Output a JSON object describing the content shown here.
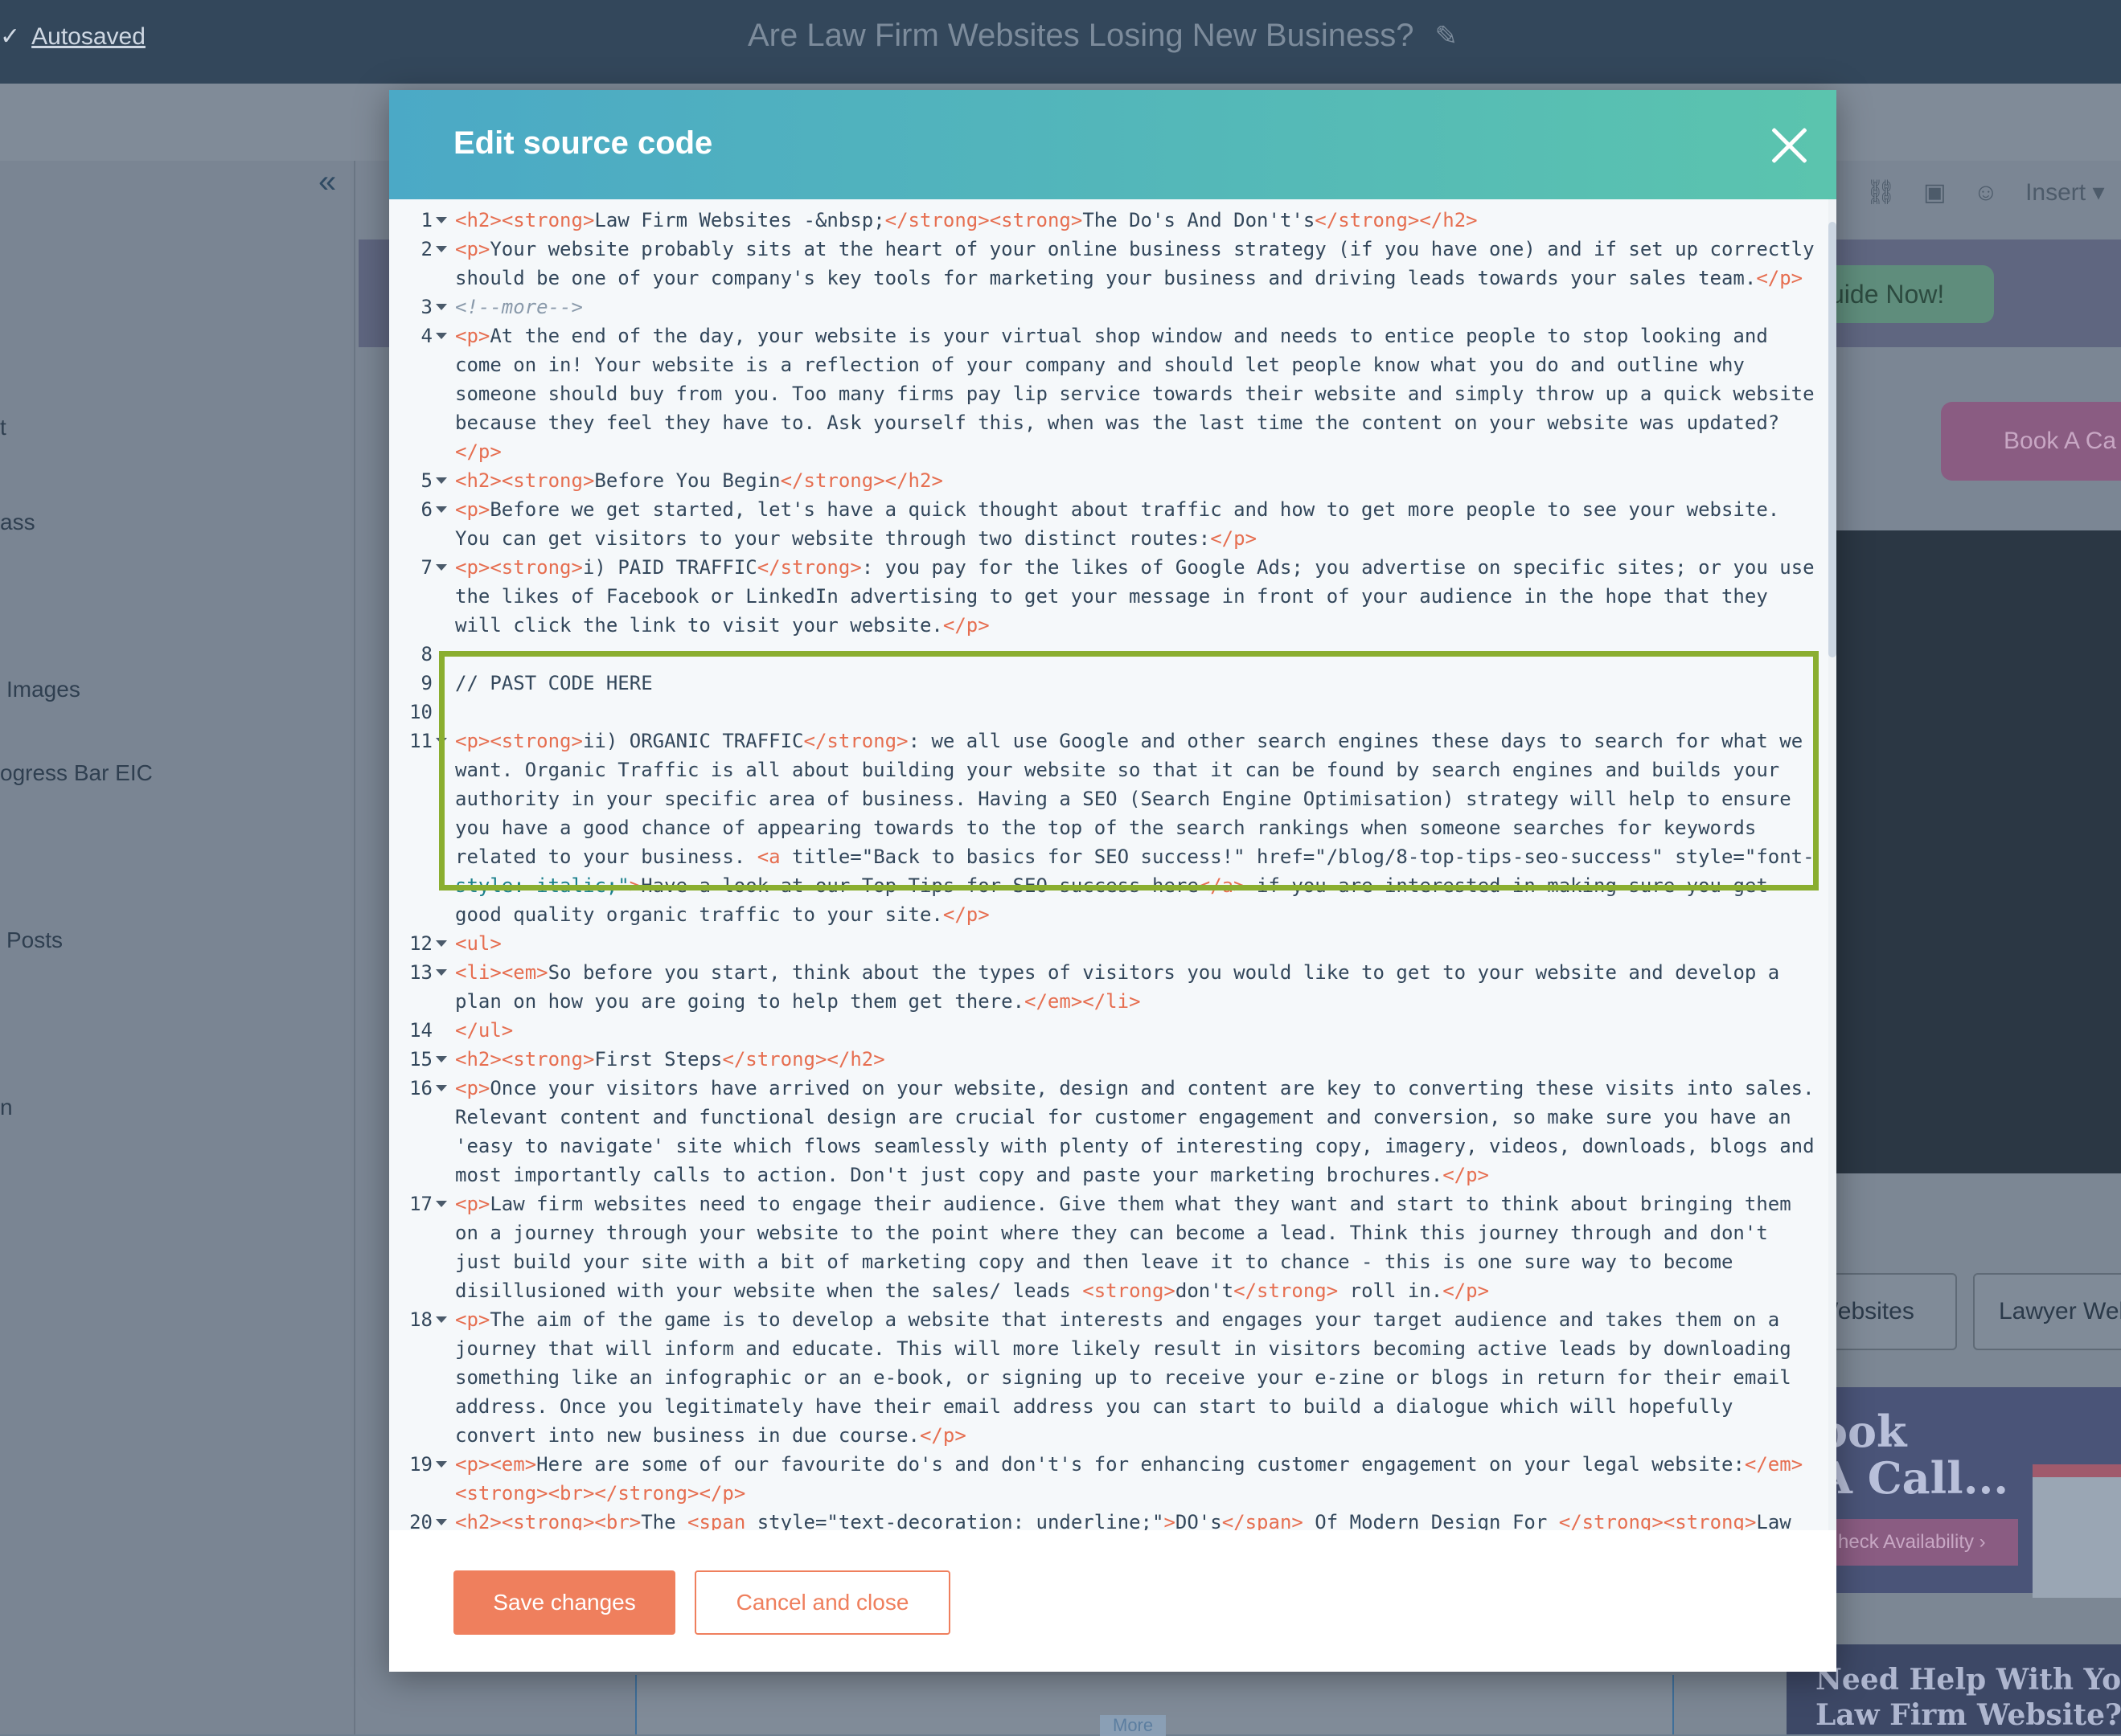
{
  "header": {
    "autosaved_label": "Autosaved",
    "doc_title": "Are Law Firm Websites Losing New Business?",
    "icons": [
      "check-icon",
      "pencil-icon"
    ]
  },
  "background": {
    "sidebar_labels": [
      "t",
      "ass",
      "Images",
      "ogress Bar EIC",
      "Posts",
      "n"
    ],
    "toolbar_insert": "Insert",
    "guide_button": "uide Now!",
    "book_button": "Book A Ca",
    "tags": [
      "Websites",
      "Lawyer Wel"
    ],
    "cta_text": "ook\nA Call...",
    "check_availability": "heck Availability",
    "help_text": "Need Help With You\nLaw Firm Website?",
    "more_label": "More"
  },
  "modal": {
    "title": "Edit source code",
    "save_label": "Save changes",
    "cancel_label": "Cancel and close",
    "colors": {
      "header_from": "#4ba9c6",
      "header_to": "#5bc4ae",
      "button": "#ef7f5d",
      "highlight": "#8aae2f"
    }
  },
  "code": {
    "line_numbers": [
      "1",
      "2",
      "3",
      "4",
      "5",
      "6",
      "7",
      "8",
      "9",
      "10",
      "11",
      "12",
      "13",
      "14",
      "15",
      "16",
      "17",
      "18",
      "19",
      "20"
    ],
    "lines": [
      "<h2><strong>Law Firm Websites -&nbsp;</strong><strong>The Do's And Don't's</strong></h2>",
      "<p>Your website probably sits at the heart of your online business strategy (if you have one) and if set up correctly",
      "should be one of your company's key tools for marketing your business and driving leads towards your sales team.</p>",
      "<!--more-->",
      "<p>At the end of the day, your website is your virtual shop window and needs to entice people to stop looking and",
      "come on in! Your website is a reflection of your company and should let people know what you do and outline why",
      "someone should buy from you. Too many firms pay lip service towards their website and simply throw up a quick website",
      "because they feel they have to. Ask yourself this, when was the last time the content on your website was updated?",
      "</p>",
      "<h2><strong>Before You Begin</strong></h2>",
      "<p>Before we get started, let's have a quick thought about traffic and how to get more people to see your website.",
      "You can get visitors to your website through two distinct routes:</p>",
      "<p><strong>i) PAID TRAFFIC</strong>: you pay for the likes of Google Ads; you advertise on specific sites; or you use",
      "the likes of Facebook or LinkedIn advertising to get your message in front of your audience in the hope that they",
      "will click the link to visit your website.</p>",
      "",
      "// PAST CODE HERE",
      "",
      "<p><strong>ii) ORGANIC TRAFFIC</strong>: we all use Google and other search engines these days to search for what we",
      "want. Organic Traffic is all about building your website so that it can be found by search engines and builds your",
      "authority in your specific area of business. Having a SEO (Search Engine Optimisation) strategy will help to ensure",
      "you have a good chance of appearing towards to the top of the search rankings when someone searches for keywords",
      "related to your business. <a title=\"Back to basics for SEO success!\" href=\"/blog/8-top-tips-seo-success\" style=\"font-",
      "style: italic;\">Have a look at our Top Tips for SEO success here</a> if you are interested in making sure you get",
      "good quality organic traffic to your site.</p>",
      "<ul>",
      "<li><em>So before you start, think about the types of visitors you would like to get to your website and develop a",
      "plan on how you are going to help them get there.</em></li>",
      "</ul>",
      "<h2><strong>First Steps</strong></h2>",
      "<p>Once your visitors have arrived on your website, design and content are key to converting these visits into sales.",
      "Relevant content and functional design are crucial for customer engagement and conversion, so make sure you have an",
      "'easy to navigate' site which flows seamlessly with plenty of interesting copy, imagery, videos, downloads, blogs and",
      "most importantly calls to action. Don't just copy and paste your marketing brochures.</p>",
      "<p>Law firm websites need to engage their audience. Give them what they want and start to think about bringing them",
      "on a journey through your website to the point where they can become a lead. Think this journey through and don't",
      "just build your site with a bit of marketing copy and then leave it to chance - this is one sure way to become",
      "disillusioned with your website when the sales/ leads <strong>don't</strong> roll in.</p>",
      "<p>The aim of the game is to develop a website that interests and engages your target audience and takes them on a",
      "journey that will inform and educate. This will more likely result in visitors becoming active leads by downloading",
      "something like an infographic or an e-book, or signing up to receive your e-zine or blogs in return for their email",
      "address. Once you legitimately have their email address you can start to build a dialogue which will hopefully",
      "convert into new business in due course.</p>",
      "<p><em>Here are some of our favourite do's and don't's for enhancing customer engagement on your legal website:</em>",
      "<strong><br></strong></p>",
      "<h2><strong><br>The <span style=\"text-decoration: underline;\">DO's</span> Of Modern Design For </strong><strong>Law"
    ],
    "line_starts": [
      0,
      1,
      3,
      4,
      9,
      10,
      12,
      15,
      16,
      17,
      18,
      25,
      26,
      28,
      29,
      30,
      34,
      38,
      43,
      45
    ]
  }
}
